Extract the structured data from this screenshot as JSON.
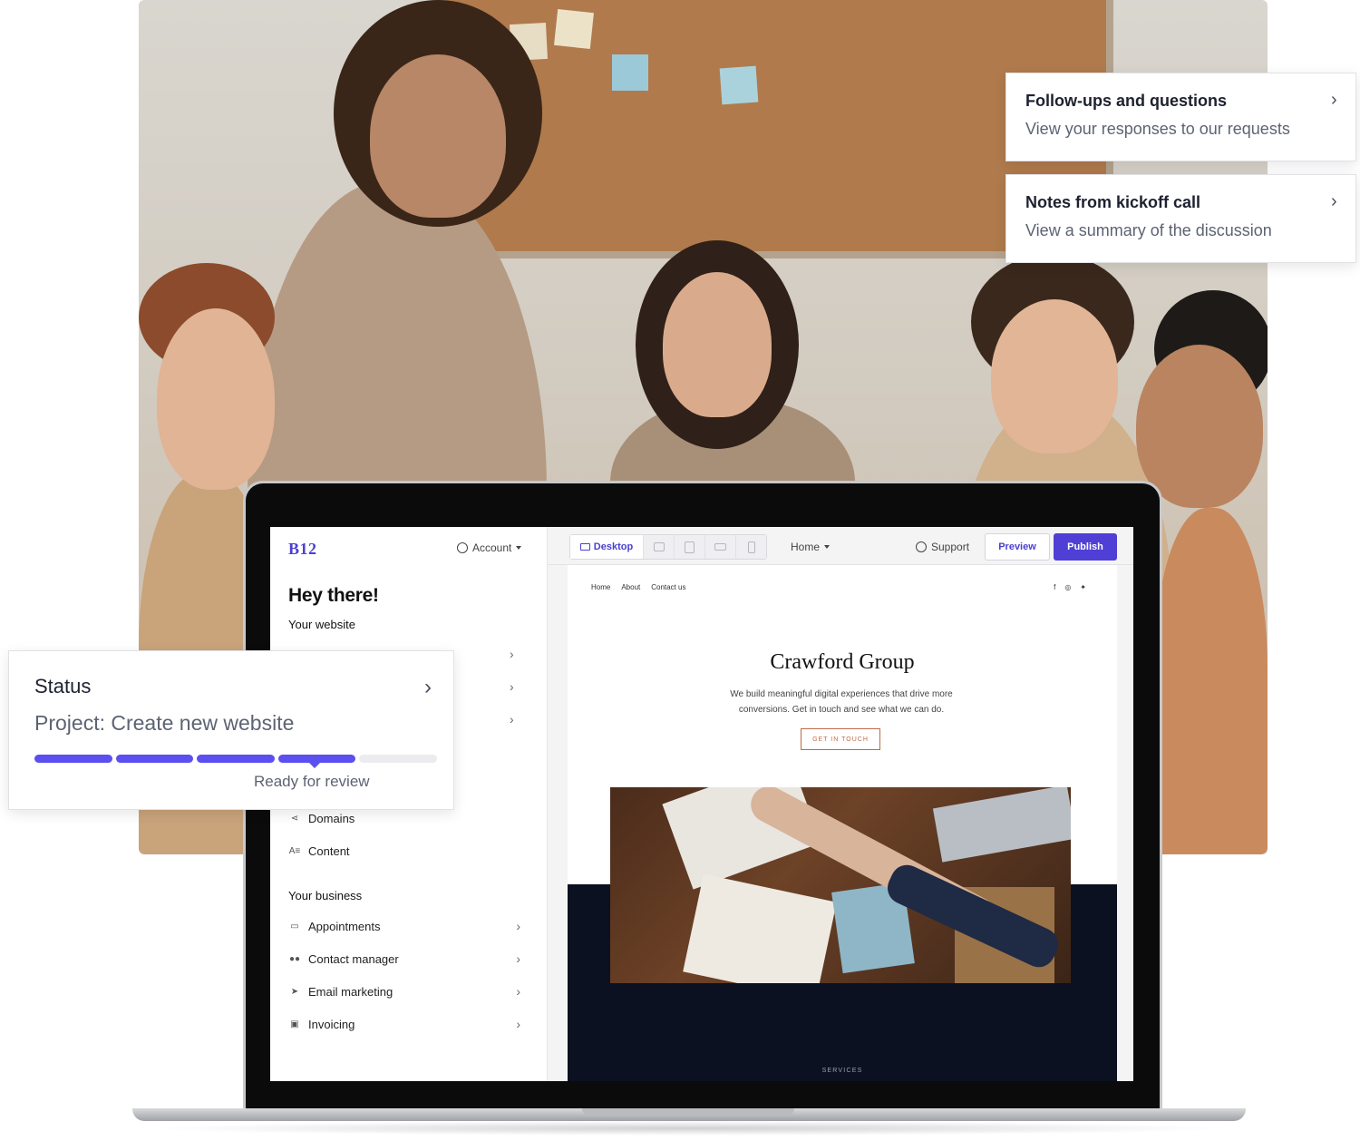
{
  "colors": {
    "brand": "#4f3fd6",
    "progress_active": "#5b4ff0",
    "progress_inactive": "#ececf0",
    "cta_accent": "#c06a46",
    "site_dark": "#0b1120"
  },
  "cards": {
    "followups": {
      "title": "Follow-ups and questions",
      "subtitle": "View your responses to our requests",
      "icon": "chevron-right-icon"
    },
    "kickoff": {
      "title": "Notes from kickoff call",
      "subtitle": "View a summary of the discussion",
      "icon": "chevron-right-icon"
    }
  },
  "status_card": {
    "title": "Status",
    "project": "Project: Create new website",
    "progress": {
      "segments_total": 5,
      "segments_complete": 4
    },
    "status_text": "Ready for review"
  },
  "app": {
    "logo": "B12",
    "account_label": "Account",
    "greeting": "Hey there!",
    "section_website": "Your website",
    "website_items": [
      {
        "label": "Domains",
        "icon": "share-icon"
      },
      {
        "label": "Content",
        "icon": "text-edit-icon"
      }
    ],
    "section_business": "Your business",
    "business_items": [
      {
        "label": "Appointments",
        "icon": "calendar-icon"
      },
      {
        "label": "Contact manager",
        "icon": "people-icon"
      },
      {
        "label": "Email marketing",
        "icon": "send-icon"
      },
      {
        "label": "Invoicing",
        "icon": "invoice-icon"
      }
    ]
  },
  "toolbar": {
    "device_active": "Desktop",
    "devices": [
      "desktop-icon",
      "tablet-landscape-icon",
      "tablet-portrait-icon",
      "phone-landscape-icon",
      "phone-portrait-icon"
    ],
    "page_select": "Home",
    "support_label": "Support",
    "preview_label": "Preview",
    "publish_label": "Publish"
  },
  "site": {
    "nav": [
      "Home",
      "About",
      "Contact us"
    ],
    "social": [
      "facebook-icon",
      "instagram-icon",
      "twitter-icon"
    ],
    "title": "Crawford Group",
    "subtitle": "We build meaningful digital experiences that drive more conversions. Get in touch and see what we can do.",
    "cta": "GET IN TOUCH",
    "section_label": "SERVICES"
  }
}
